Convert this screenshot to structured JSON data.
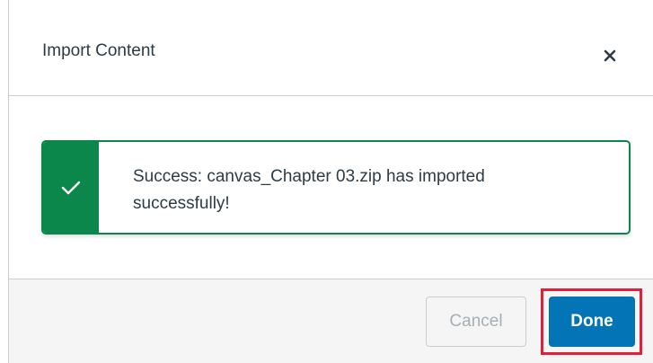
{
  "dialog": {
    "title": "Import Content",
    "close_icon": "close-icon"
  },
  "alert": {
    "icon": "checkmark-icon",
    "message": "Success: canvas_Chapter 03.zip has imported successfully!",
    "color": "#0b874b"
  },
  "footer": {
    "cancel_label": "Cancel",
    "done_label": "Done",
    "primary_color": "#0374b5",
    "highlight_color": "#e0203a"
  }
}
